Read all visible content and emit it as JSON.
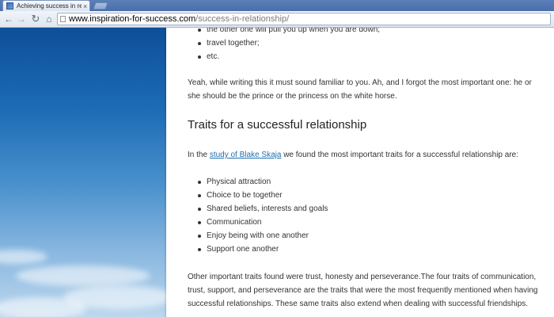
{
  "browser": {
    "tab_title": "Achieving success in relat",
    "tab_close": "×",
    "url_domain": "www.inspiration-for-success.com",
    "url_path": "/success-in-relationship/",
    "back_icon": "←",
    "forward_icon": "→",
    "reload_icon": "↻",
    "home_icon": "⌂"
  },
  "article": {
    "top_list": [
      "the other one will pull you up when you are down;",
      "travel together;",
      "etc."
    ],
    "para1": "Yeah, while writing this it must sound familiar to you. Ah, and I forgot the most important one: he or she should be the prince or the princess on the white horse.",
    "heading": "Traits for a successful relationship",
    "intro_before": "In the ",
    "intro_link": "study of Blake Skaja",
    "intro_after": " we found the most important traits for a successful relationship are:",
    "traits": [
      "Physical attraction",
      "Choice to be together",
      "Shared beliefs, interests and goals",
      "Communication",
      "Enjoy being with one another",
      "Support one another"
    ],
    "para2": "Other important traits found were trust, honesty and perseverance.The four traits of communication, trust, support, and perseverance are the traits that were the most frequently mentioned when having successful relationships. These same traits also extend when dealing with successful friendships."
  }
}
